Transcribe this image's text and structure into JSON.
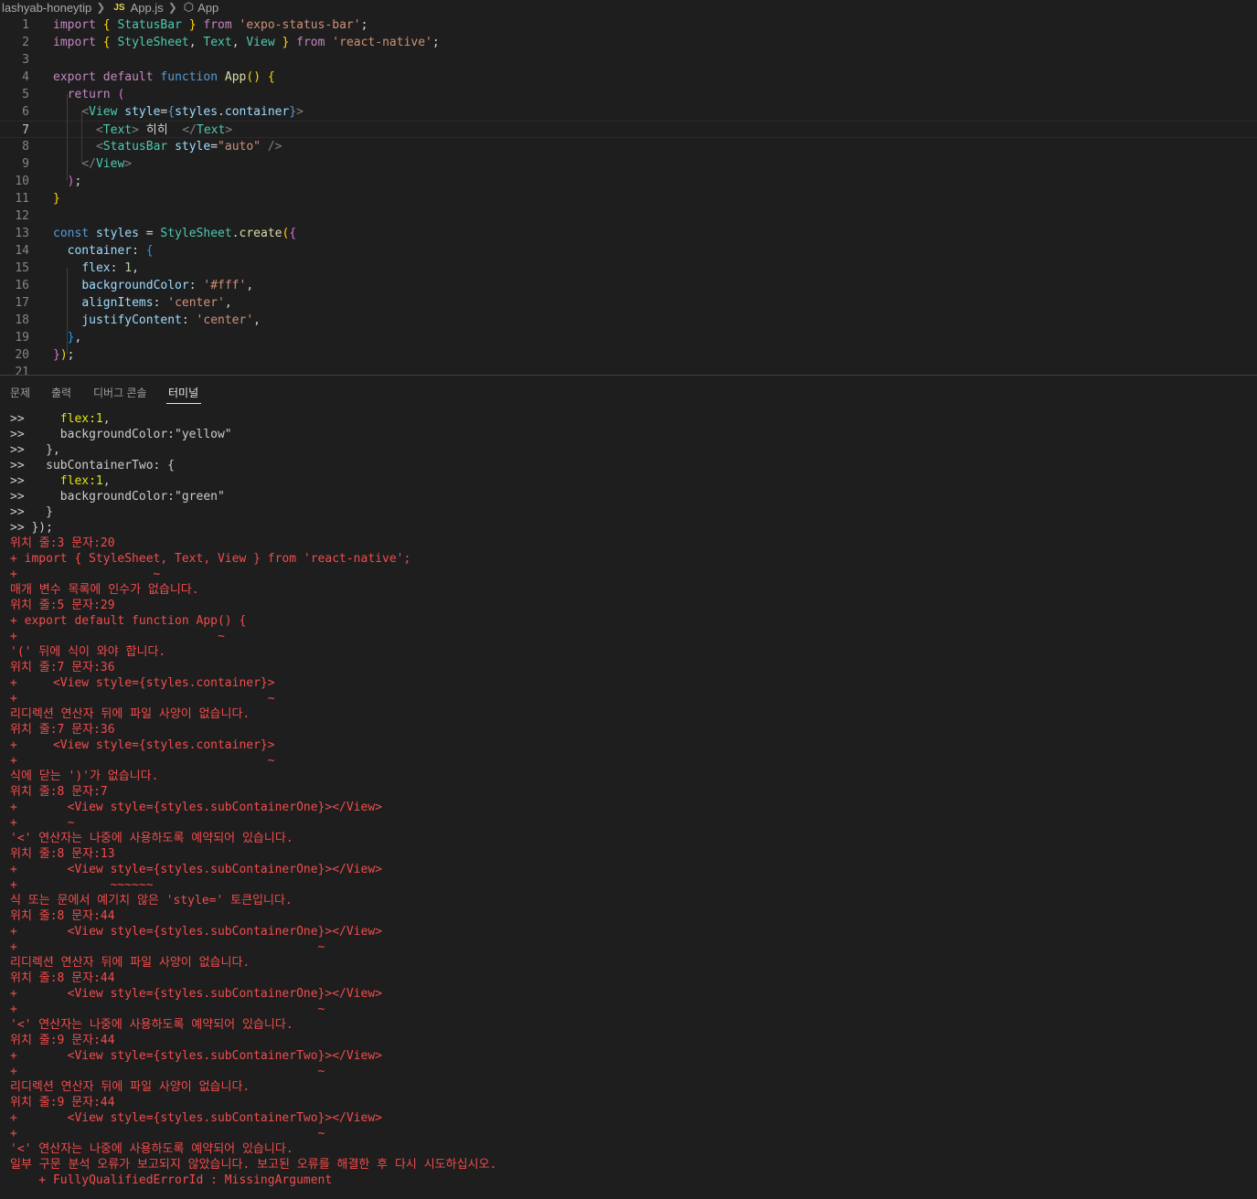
{
  "breadcrumb": {
    "folder": "lashyab-honeytip",
    "file_badge": "JS",
    "file": "App.js",
    "symbol": "App"
  },
  "editor": {
    "active_line": 7,
    "lines": [
      {
        "n": "1",
        "t": "import { StatusBar } from 'expo-status-bar';"
      },
      {
        "n": "2",
        "t": "import { StyleSheet, Text, View } from 'react-native';"
      },
      {
        "n": "3",
        "t": ""
      },
      {
        "n": "4",
        "t": "export default function App() {"
      },
      {
        "n": "5",
        "t": "  return ("
      },
      {
        "n": "6",
        "t": "    <View style={styles.container}>"
      },
      {
        "n": "7",
        "t": "      <Text> 히히  </Text>"
      },
      {
        "n": "8",
        "t": "      <StatusBar style=\"auto\" />"
      },
      {
        "n": "9",
        "t": "    </View>"
      },
      {
        "n": "10",
        "t": "  );"
      },
      {
        "n": "11",
        "t": "}"
      },
      {
        "n": "12",
        "t": ""
      },
      {
        "n": "13",
        "t": "const styles = StyleSheet.create({"
      },
      {
        "n": "14",
        "t": "  container: {"
      },
      {
        "n": "15",
        "t": "    flex: 1,"
      },
      {
        "n": "16",
        "t": "    backgroundColor: '#fff',"
      },
      {
        "n": "17",
        "t": "    alignItems: 'center',"
      },
      {
        "n": "18",
        "t": "    justifyContent: 'center',"
      },
      {
        "n": "19",
        "t": "  },"
      },
      {
        "n": "20",
        "t": "});"
      },
      {
        "n": "21",
        "t": ""
      }
    ]
  },
  "panel": {
    "tabs": [
      {
        "label": "문제",
        "active": false
      },
      {
        "label": "출력",
        "active": false
      },
      {
        "label": "디버그 콘솔",
        "active": false
      },
      {
        "label": "터미널",
        "active": true
      }
    ]
  },
  "terminal": {
    "lines": [
      {
        "text": ">>     flex:1,",
        "type": "normal"
      },
      {
        "text": ">>     backgroundColor:\"yellow\"",
        "type": "normal"
      },
      {
        "text": ">>   },",
        "type": "normal"
      },
      {
        "text": ">>   subContainerTwo: {",
        "type": "normal"
      },
      {
        "text": ">>     flex:1,",
        "type": "normal"
      },
      {
        "text": ">>     backgroundColor:\"green\"",
        "type": "normal"
      },
      {
        "text": ">>   }",
        "type": "normal"
      },
      {
        "text": ">> });",
        "type": "normal"
      },
      {
        "text": "위치 줄:3 문자:20",
        "type": "err"
      },
      {
        "text": "+ import { StyleSheet, Text, View } from 'react-native';",
        "type": "err"
      },
      {
        "text": "+                   ~",
        "type": "err"
      },
      {
        "text": "매개 변수 목록에 인수가 없습니다.",
        "type": "err"
      },
      {
        "text": "위치 줄:5 문자:29",
        "type": "err"
      },
      {
        "text": "+ export default function App() {",
        "type": "err"
      },
      {
        "text": "+                            ~",
        "type": "err"
      },
      {
        "text": "'(' 뒤에 식이 와야 합니다.",
        "type": "err"
      },
      {
        "text": "위치 줄:7 문자:36",
        "type": "err"
      },
      {
        "text": "+     <View style={styles.container}>",
        "type": "err"
      },
      {
        "text": "+                                   ~",
        "type": "err"
      },
      {
        "text": "리디렉션 연산자 뒤에 파일 사양이 없습니다.",
        "type": "err"
      },
      {
        "text": "위치 줄:7 문자:36",
        "type": "err"
      },
      {
        "text": "+     <View style={styles.container}>",
        "type": "err"
      },
      {
        "text": "+                                   ~",
        "type": "err"
      },
      {
        "text": "식에 닫는 ')'가 없습니다.",
        "type": "err"
      },
      {
        "text": "위치 줄:8 문자:7",
        "type": "err"
      },
      {
        "text": "+       <View style={styles.subContainerOne}></View>",
        "type": "err"
      },
      {
        "text": "+       ~",
        "type": "err"
      },
      {
        "text": "'<' 연산자는 나중에 사용하도록 예약되어 있습니다.",
        "type": "err"
      },
      {
        "text": "위치 줄:8 문자:13",
        "type": "err"
      },
      {
        "text": "+       <View style={styles.subContainerOne}></View>",
        "type": "err"
      },
      {
        "text": "+             ~~~~~~",
        "type": "err"
      },
      {
        "text": "식 또는 문에서 예기치 않은 'style=' 토큰입니다.",
        "type": "err"
      },
      {
        "text": "위치 줄:8 문자:44",
        "type": "err"
      },
      {
        "text": "+       <View style={styles.subContainerOne}></View>",
        "type": "err"
      },
      {
        "text": "+                                          ~",
        "type": "err"
      },
      {
        "text": "리디렉션 연산자 뒤에 파일 사양이 없습니다.",
        "type": "err"
      },
      {
        "text": "위치 줄:8 문자:44",
        "type": "err"
      },
      {
        "text": "+       <View style={styles.subContainerOne}></View>",
        "type": "err"
      },
      {
        "text": "+                                          ~",
        "type": "err"
      },
      {
        "text": "'<' 연산자는 나중에 사용하도록 예약되어 있습니다.",
        "type": "err"
      },
      {
        "text": "위치 줄:9 문자:44",
        "type": "err"
      },
      {
        "text": "+       <View style={styles.subContainerTwo}></View>",
        "type": "err"
      },
      {
        "text": "+                                          ~",
        "type": "err"
      },
      {
        "text": "리디렉션 연산자 뒤에 파일 사양이 없습니다.",
        "type": "err"
      },
      {
        "text": "위치 줄:9 문자:44",
        "type": "err"
      },
      {
        "text": "+       <View style={styles.subContainerTwo}></View>",
        "type": "err"
      },
      {
        "text": "+                                          ~",
        "type": "err"
      },
      {
        "text": "'<' 연산자는 나중에 사용하도록 예약되어 있습니다.",
        "type": "err"
      },
      {
        "text": "일부 구문 분석 오류가 보고되지 않았습니다. 보고된 오류를 해결한 후 다시 시도하십시오.",
        "type": "err"
      },
      {
        "text": "    + FullyQualifiedErrorId : MissingArgument",
        "type": "err"
      }
    ]
  }
}
